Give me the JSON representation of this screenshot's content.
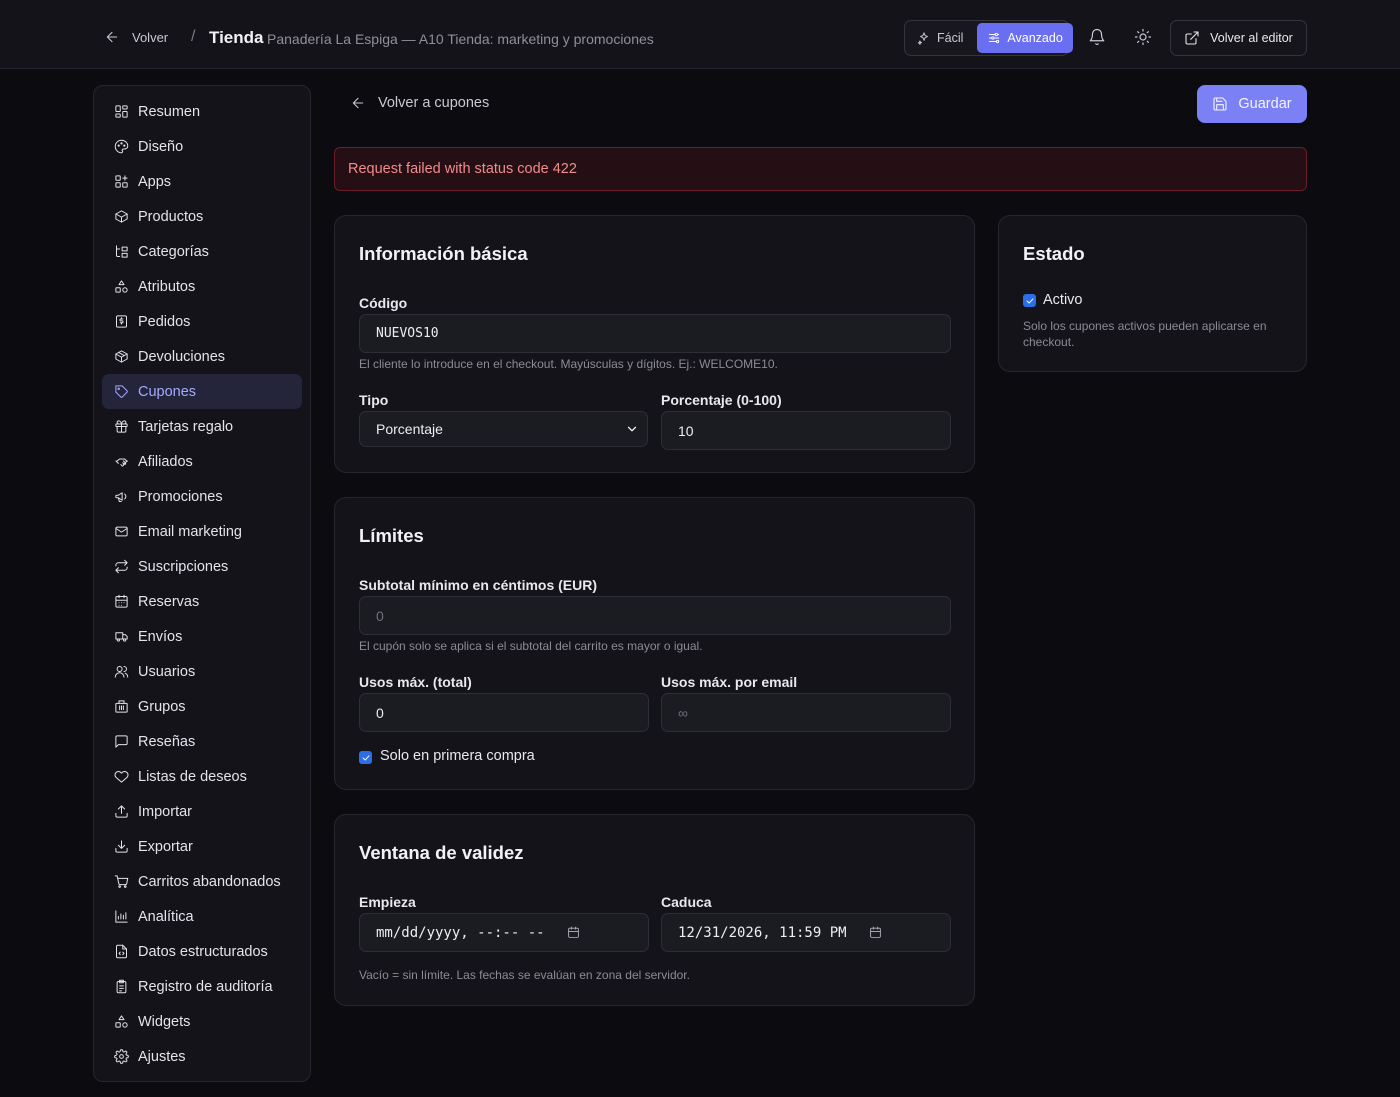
{
  "header": {
    "back_label": "Volver",
    "separator": "/",
    "title": "Tienda",
    "subtitle": "Panadería La Espiga — A10 Tienda: marketing y promociones",
    "mode_easy": "Fácil",
    "mode_advanced": "Avanzado",
    "editor_label": "Volver al editor"
  },
  "sidebar": {
    "items": [
      {
        "label": "Resumen",
        "icon": "dashboard-icon"
      },
      {
        "label": "Diseño",
        "icon": "palette-icon"
      },
      {
        "label": "Apps",
        "icon": "apps-icon"
      },
      {
        "label": "Productos",
        "icon": "package-icon"
      },
      {
        "label": "Categorías",
        "icon": "tree-icon"
      },
      {
        "label": "Atributos",
        "icon": "shapes-icon"
      },
      {
        "label": "Pedidos",
        "icon": "receipt-icon"
      },
      {
        "label": "Devoluciones",
        "icon": "package-return-icon"
      },
      {
        "label": "Cupones",
        "icon": "tag-icon"
      },
      {
        "label": "Tarjetas regalo",
        "icon": "gift-icon"
      },
      {
        "label": "Afiliados",
        "icon": "handshake-icon"
      },
      {
        "label": "Promociones",
        "icon": "megaphone-icon"
      },
      {
        "label": "Email marketing",
        "icon": "mail-icon"
      },
      {
        "label": "Suscripciones",
        "icon": "repeat-icon"
      },
      {
        "label": "Reservas",
        "icon": "calendar-icon"
      },
      {
        "label": "Envíos",
        "icon": "truck-icon"
      },
      {
        "label": "Usuarios",
        "icon": "users-icon"
      },
      {
        "label": "Grupos",
        "icon": "building-icon"
      },
      {
        "label": "Reseñas",
        "icon": "message-icon"
      },
      {
        "label": "Listas de deseos",
        "icon": "heart-icon"
      },
      {
        "label": "Importar",
        "icon": "upload-icon"
      },
      {
        "label": "Exportar",
        "icon": "download-icon"
      },
      {
        "label": "Carritos abandonados",
        "icon": "cart-icon"
      },
      {
        "label": "Analítica",
        "icon": "chart-icon"
      },
      {
        "label": "Datos estructurados",
        "icon": "file-code-icon"
      },
      {
        "label": "Registro de auditoría",
        "icon": "clipboard-icon"
      },
      {
        "label": "Widgets",
        "icon": "widgets-icon"
      },
      {
        "label": "Ajustes",
        "icon": "gear-icon"
      }
    ],
    "active_index": 8
  },
  "main": {
    "back_label": "Volver a cupones",
    "save_label": "Guardar",
    "error": "Request failed with status code 422"
  },
  "basic": {
    "title": "Información básica",
    "code_label": "Código",
    "code_value": "NUEVOS10",
    "code_help": "El cliente lo introduce en el checkout. Mayúsculas y dígitos. Ej.: WELCOME10.",
    "type_label": "Tipo",
    "type_value": "Porcentaje",
    "percent_label": "Porcentaje (0-100)",
    "percent_value": "10"
  },
  "limits": {
    "title": "Límites",
    "min_label": "Subtotal mínimo en céntimos (EUR)",
    "min_placeholder": "0",
    "min_help": "El cupón solo se aplica si el subtotal del carrito es mayor o igual.",
    "max_total_label": "Usos máx. (total)",
    "max_total_value": "0",
    "max_email_label": "Usos máx. por email",
    "max_email_placeholder": "∞",
    "first_purchase_label": "Solo en primera compra"
  },
  "validity": {
    "title": "Ventana de validez",
    "start_label": "Empieza",
    "start_value": "mm/dd/yyyy, --:-- --",
    "end_label": "Caduca",
    "end_value": "12/31/2026, 11:59 PM",
    "help": "Vacío = sin límite. Las fechas se evalúan en zona del servidor."
  },
  "status": {
    "title": "Estado",
    "active_label": "Activo",
    "help": "Solo los cupones activos pueden aplicarse en checkout."
  },
  "colors": {
    "accent": "#6a6ff2",
    "error_text": "#f28b8b",
    "checkbox": "#2b6ee8"
  }
}
